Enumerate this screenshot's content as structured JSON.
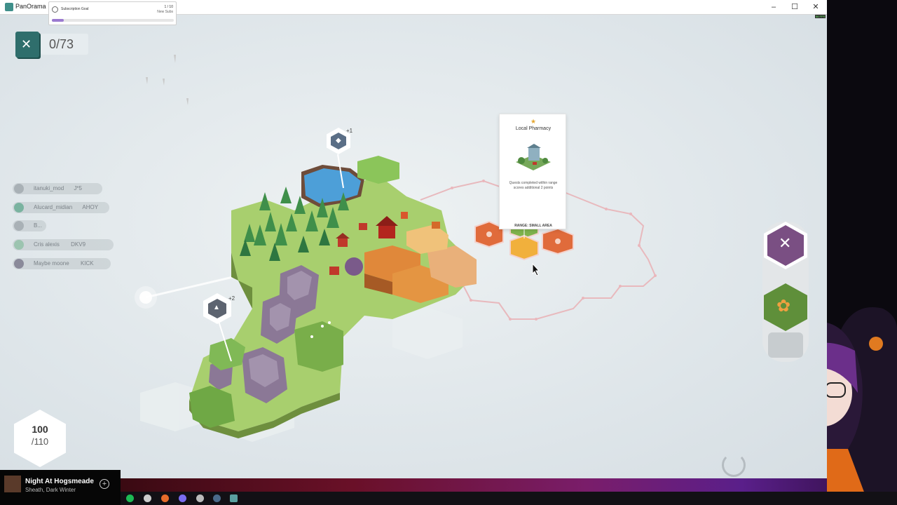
{
  "window": {
    "title": "PanOrama"
  },
  "subscription": {
    "label": "Subscription Goal",
    "count": "1 / 10",
    "subtitle": "New Subs",
    "progress": 0.1
  },
  "quests": {
    "count": "0/73"
  },
  "chat": [
    {
      "user": "itanuki_mod",
      "badge": "J*5"
    },
    {
      "user": "Alucard_midian",
      "badge": "AHOY"
    },
    {
      "user": "B...",
      "badge": ""
    },
    {
      "user": "Cris alexis",
      "badge": "DKV9"
    },
    {
      "user": "Maybe moone",
      "badge": "KICK"
    }
  ],
  "markers": [
    {
      "label": "+1",
      "icon": "water-drop-icon"
    },
    {
      "label": "+2",
      "icon": "rock-icon"
    }
  ],
  "card": {
    "title": "Local Pharmacy",
    "description": "Quests completed within range scores additional 2 points",
    "range": "RANGE: SMALL AREA"
  },
  "score": {
    "current": "100",
    "max": "/110"
  },
  "music": {
    "title": "Night At Hogsmeade",
    "artist": "Sheath, Dark Winter"
  },
  "fps": "56 FPS",
  "colors": {
    "window_bg": "#dfe6ea",
    "accent_purple": "#7a4f83",
    "quest_teal": "#2f6e6c",
    "forest": "#4f9a45",
    "farm_orange": "#e08a3a",
    "rock": "#8b7896"
  }
}
